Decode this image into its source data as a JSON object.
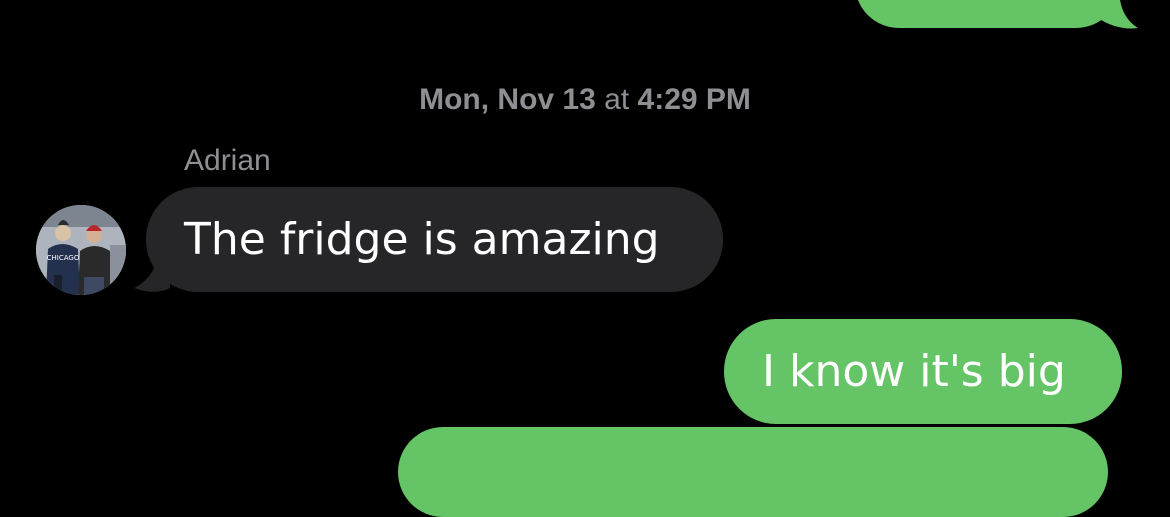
{
  "conversation": {
    "timestamp": {
      "date": "Mon, Nov 13",
      "connector": "at",
      "time": "4:29 PM"
    },
    "sender_name": "Adrian",
    "messages": [
      {
        "direction": "incoming",
        "text": "The fridge is amazing"
      },
      {
        "direction": "outgoing",
        "text": "I know it's big"
      }
    ]
  },
  "avatar": {
    "shirt_text": "CHICAGO"
  },
  "colors": {
    "background": "#000000",
    "outgoing_bubble": "#65C466",
    "incoming_bubble": "#262628",
    "meta_text": "#8E8E93",
    "message_text": "#FFFFFF"
  }
}
